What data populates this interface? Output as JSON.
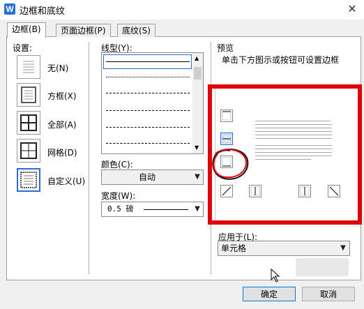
{
  "window": {
    "icon_letter": "W",
    "title": "边框和底纹",
    "close_glyph": "✕"
  },
  "tabs": [
    {
      "label": "边框(B)",
      "active": true
    },
    {
      "label": "页面边框(P)",
      "active": false
    },
    {
      "label": "底纹(S)",
      "active": false
    }
  ],
  "settings": {
    "heading": "设置:",
    "items": [
      {
        "label": "无(N)",
        "icon": "none-setting-icon"
      },
      {
        "label": "方框(X)",
        "icon": "box-setting-icon"
      },
      {
        "label": "全部(A)",
        "icon": "all-setting-icon"
      },
      {
        "label": "网格(D)",
        "icon": "grid-setting-icon"
      },
      {
        "label": "自定义(U)",
        "icon": "custom-setting-icon",
        "selected": true
      }
    ]
  },
  "line_style": {
    "heading": "线型(Y):",
    "styles": [
      "solid",
      "dotted",
      "dashed-short",
      "dash-dot",
      "dash-dot-dot",
      "long-dash"
    ]
  },
  "color": {
    "label": "颜色(C):",
    "value": "自动"
  },
  "width": {
    "label": "宽度(W):",
    "value": "0.5  磅"
  },
  "preview": {
    "heading": "预览",
    "hint": "单击下方图示或按钮可设置边框",
    "annotation_color": "#e0000a"
  },
  "apply_to": {
    "label": "应用于(L):",
    "value": "单元格"
  },
  "buttons": {
    "ok": "确定",
    "cancel": "取消"
  },
  "colors": {
    "accent": "#2b6fd6",
    "highlight": "#e0000a"
  }
}
